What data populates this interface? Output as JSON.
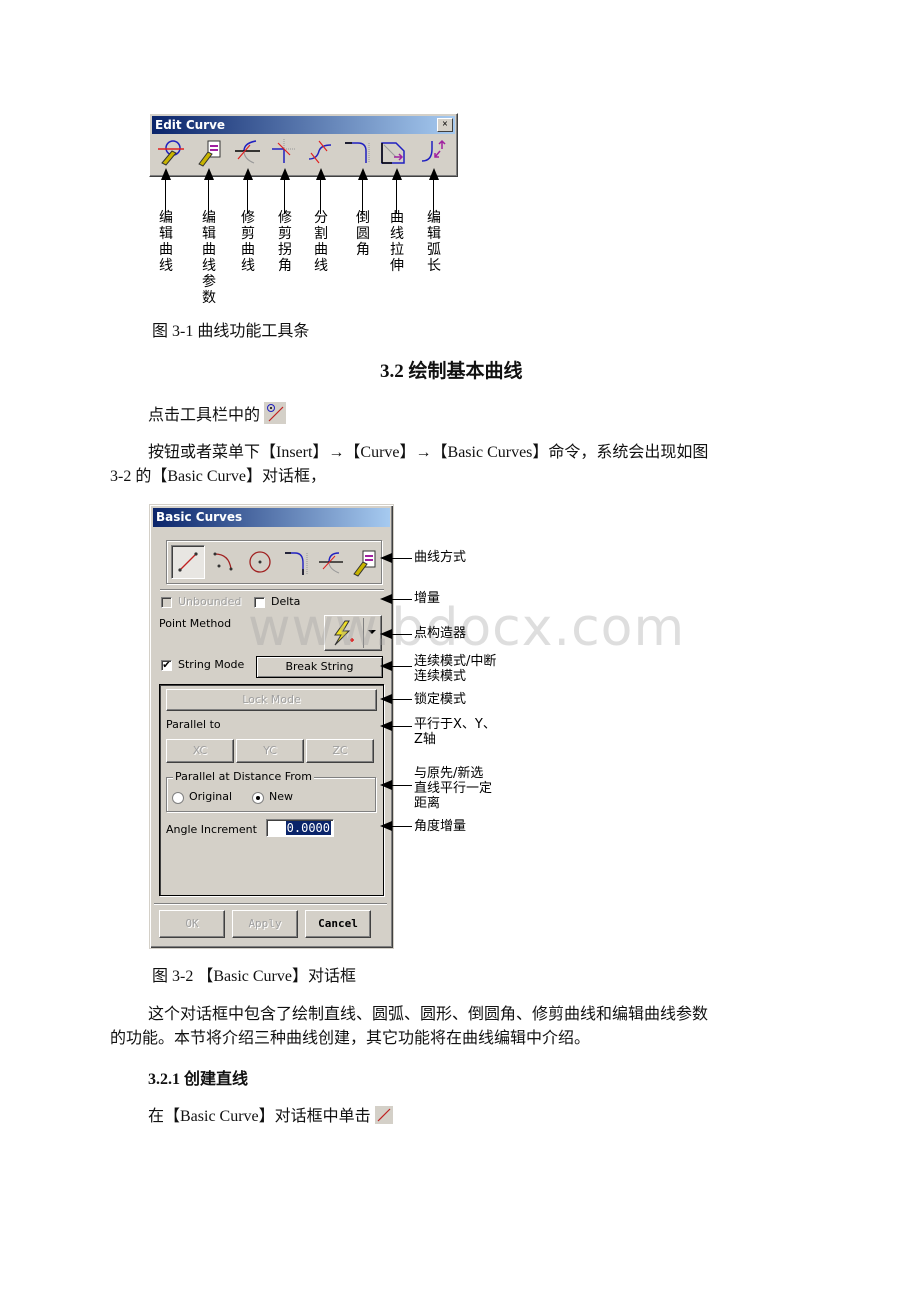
{
  "edit_curve_toolbar": {
    "title": "Edit Curve",
    "close_label": "×",
    "tools": [
      {
        "icon": "edit-curve-icon",
        "label": "编辑曲线"
      },
      {
        "icon": "edit-curve-parameters-icon",
        "label": "编辑曲线参数"
      },
      {
        "icon": "trim-curve-icon",
        "label": "修剪曲线"
      },
      {
        "icon": "trim-corner-icon",
        "label": "修剪拐角"
      },
      {
        "icon": "divide-curve-icon",
        "label": "分割曲线"
      },
      {
        "icon": "fillet-icon",
        "label": "倒圆角"
      },
      {
        "icon": "curve-stretch-icon",
        "label": "曲线拉伸"
      },
      {
        "icon": "edit-arc-length-icon",
        "label": "编辑弧长"
      }
    ]
  },
  "figure_3_1_caption": "图 3-1 曲线功能工具条",
  "section_heading": "3.2 绘制基本曲线",
  "para_1": "点击工具栏中的",
  "para_2_line1": "按钮或者菜单下【Insert】→【Curve】→【Basic Curves】命令，系统会出现如图",
  "para_2_line2": "3-2 的【Basic Curve】对话框，",
  "basic_curves_dialog": {
    "title": "Basic Curves",
    "curve_types": [
      {
        "icon": "line-icon",
        "selected": true
      },
      {
        "icon": "arc-icon",
        "selected": false
      },
      {
        "icon": "circle-icon",
        "selected": false
      },
      {
        "icon": "fillet-icon",
        "selected": false
      },
      {
        "icon": "trim-icon",
        "selected": false
      },
      {
        "icon": "edit-curve-parameters-icon",
        "selected": false
      }
    ],
    "unbounded_label": "Unbounded",
    "unbounded_checked": false,
    "delta_label": "Delta",
    "delta_checked": false,
    "point_method_label": "Point Method",
    "string_mode_label": "String Mode",
    "string_mode_checked": true,
    "break_string_label": "Break String",
    "lock_mode_label": "Lock Mode",
    "parallel_to_label": "Parallel to",
    "xc_label": "XC",
    "yc_label": "YC",
    "zc_label": "ZC",
    "parallel_distance_group": "Parallel at Distance From",
    "original_label": "Original",
    "new_label": "New",
    "selected_radio": "New",
    "angle_increment_label": "Angle Increment",
    "angle_increment_value": "0.0000",
    "ok_label": "OK",
    "apply_label": "Apply",
    "cancel_label": "Cancel"
  },
  "annotations": [
    "曲线方式",
    "增量",
    "点构造器",
    "连续模式/中断\n连续模式",
    "锁定模式",
    "平行于X、Y、\nZ轴",
    "与原先/新选\n直线平行一定\n距离",
    "角度增量"
  ],
  "watermark": "www.bdocx.com",
  "figure_3_2_caption": "图 3-2 【Basic Curve】对话框",
  "para_3_line1": "这个对话框中包含了绘制直线、圆弧、圆形、倒圆角、修剪曲线和编辑曲线参数",
  "para_3_line2": "的功能。本节将介绍三种曲线创建，其它功能将在曲线编辑中介绍。",
  "subsection_heading": "3.2.1 创建直线",
  "para_4": "在【Basic Curve】对话框中单击"
}
